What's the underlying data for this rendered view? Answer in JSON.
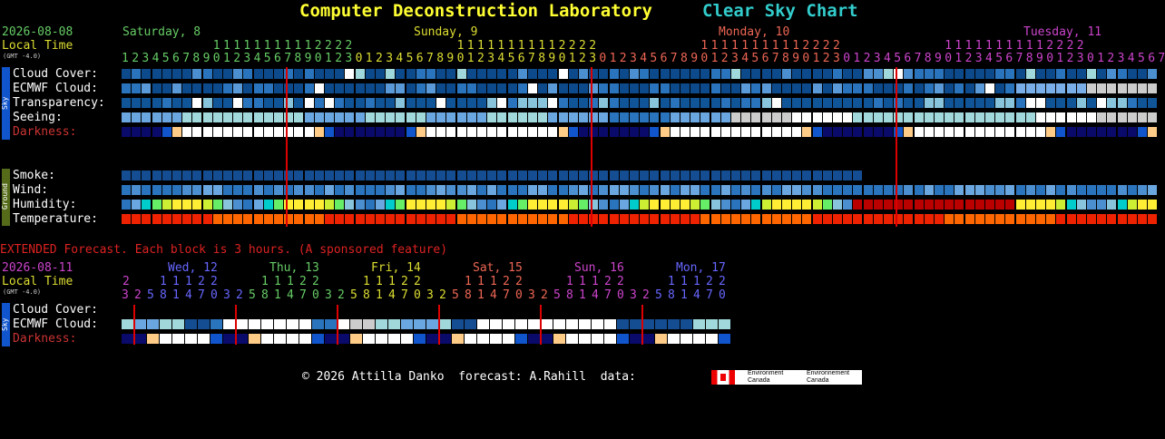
{
  "header": {
    "date": "2026-08-08",
    "local_time": "Local Time",
    "gmt": "(GMT -4.0)",
    "title": "Computer Deconstruction Laboratory",
    "subtitle": "Clear Sky Chart",
    "days": [
      {
        "label": "Saturday, 8",
        "color": "#66cc66"
      },
      {
        "label": "Sunday, 9",
        "color": "#dddd33"
      },
      {
        "label": "Monday, 10",
        "color": "#ee6655"
      },
      {
        "label": "Tuesday, 11",
        "color": "#cc44cc"
      }
    ],
    "hours_row1": "1111111111222211111111111122221111111111112222111111111112",
    "hours_row2": "1234567890123012345678901230123456789012301234567890123012345678901230123456789"
  },
  "sidebars": {
    "sky": "Sky",
    "ground": "Ground"
  },
  "rows": {
    "cloud": "Cloud Cover:",
    "ecmwf": "ECMWF Cloud:",
    "transparency": "Transparency:",
    "seeing": "Seeing:",
    "darkness": "Darkness:",
    "smoke": "Smoke:",
    "wind": "Wind:",
    "humidity": "Humidity:",
    "temperature": "Temperature:"
  },
  "extended": {
    "note": "EXTENDED Forecast. Each block is 3 hours. (A sponsored feature)",
    "date": "2026-08-11",
    "local_time": "Local Time",
    "gmt": "(GMT -4.0)",
    "days": [
      {
        "label": "Wed, 12",
        "color": "#6666ff"
      },
      {
        "label": "Thu, 13",
        "color": "#66cc66"
      },
      {
        "label": "Fri, 14",
        "color": "#dddd33"
      },
      {
        "label": "Sat, 15",
        "color": "#ee6655"
      },
      {
        "label": "Sun, 16",
        "color": "#cc44cc"
      },
      {
        "label": "Mon, 17",
        "color": "#6666ff"
      }
    ],
    "row_first_label": "2",
    "hours_top": "11122",
    "hours_bottom": "32581470325814703258147032581470325814703258147032581470",
    "rows": {
      "cloud": "Cloud Cover:",
      "ecmwf": "ECMWF Cloud:",
      "darkness": "Darkness:"
    }
  },
  "footer": {
    "copyright": "© 2026 Attilla Danko  forecast: A.Rahill  data:",
    "logo_en": "Environment Canada",
    "logo_fr": "Environnement Canada"
  },
  "colors": {
    "darkness_label": "#cc3333",
    "date": "#66cc66",
    "local": "#dddd33",
    "red_line": "#dd0000",
    "extended_note": "#dd2222"
  }
}
